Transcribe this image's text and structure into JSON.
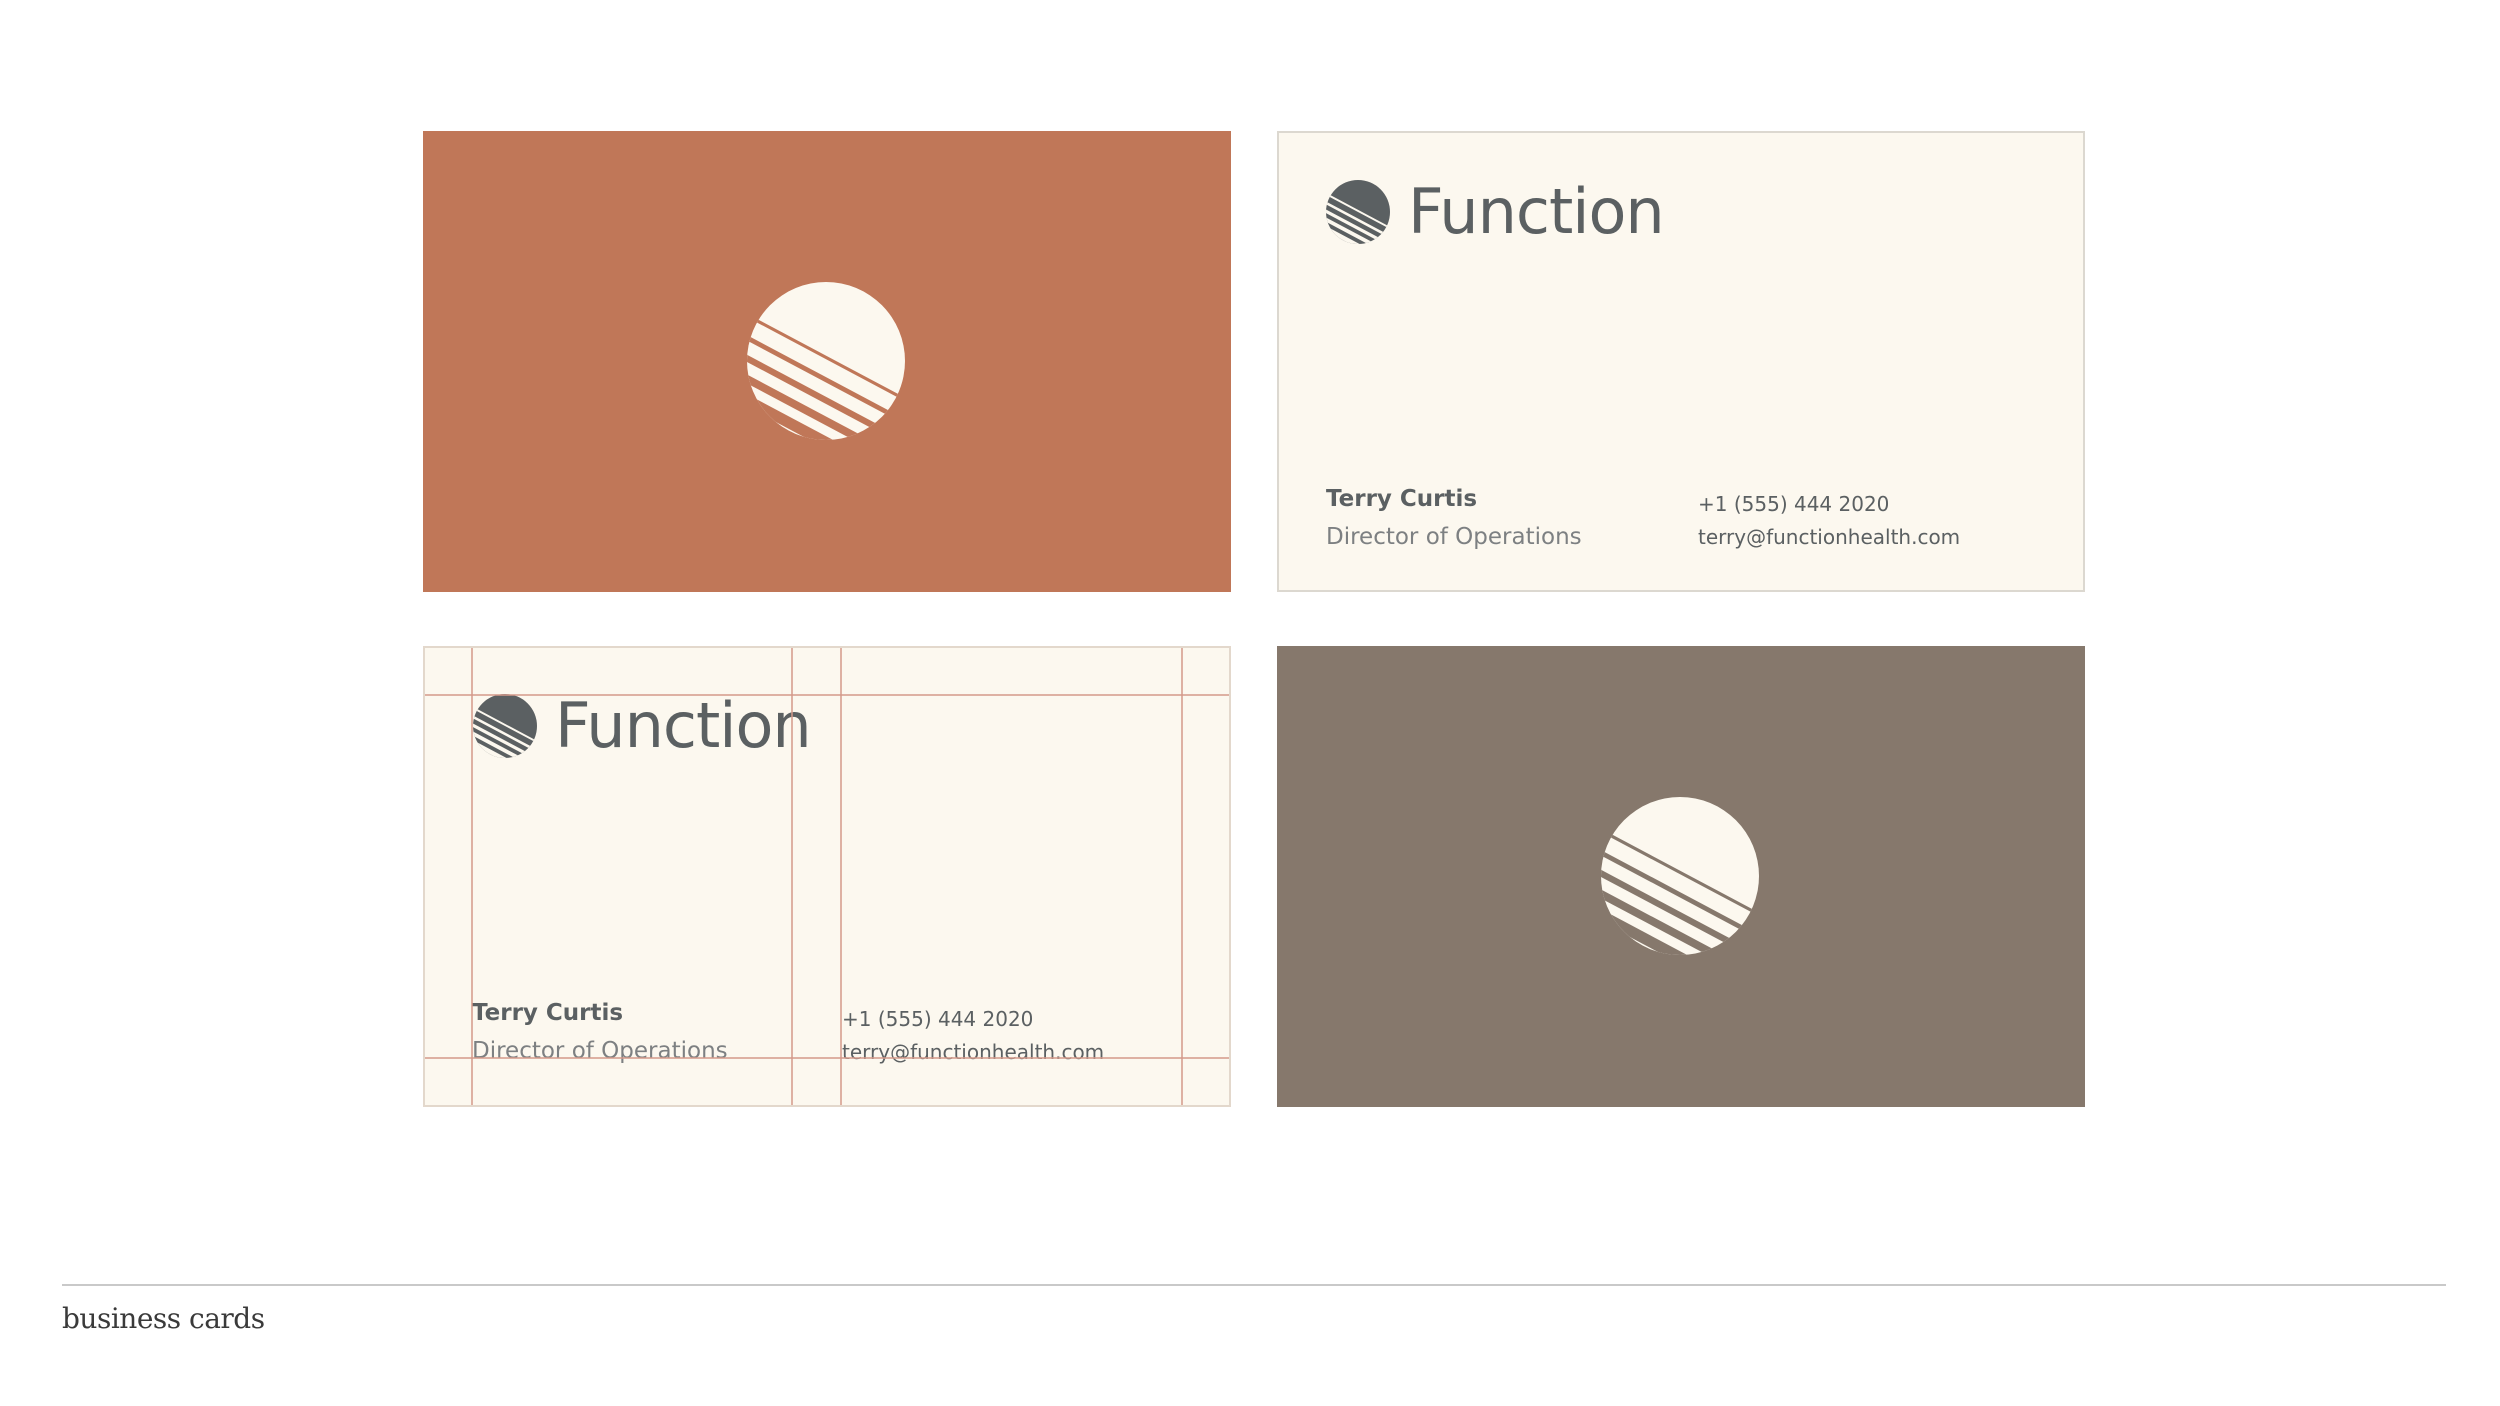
{
  "colors": {
    "page_background": "#ffffff",
    "terracotta": "#c07758",
    "cream": "#fcf8ef",
    "taupe": "#86786c",
    "charcoal": "#5b6062",
    "muted_text": "#7d8082",
    "guide_line": "#d4998a",
    "footer_rule": "#c9c9c9",
    "footer_text": "#3a3a3a"
  },
  "brand": {
    "wordmark": "Function",
    "mark_icon": "sun-stripes-icon"
  },
  "contact": {
    "name": "Terry Curtis",
    "title": "Director of Operations",
    "phone": "+1 (555) 444 2020",
    "email": "terry@functionhealth.com"
  },
  "footer": {
    "caption": "business cards"
  }
}
